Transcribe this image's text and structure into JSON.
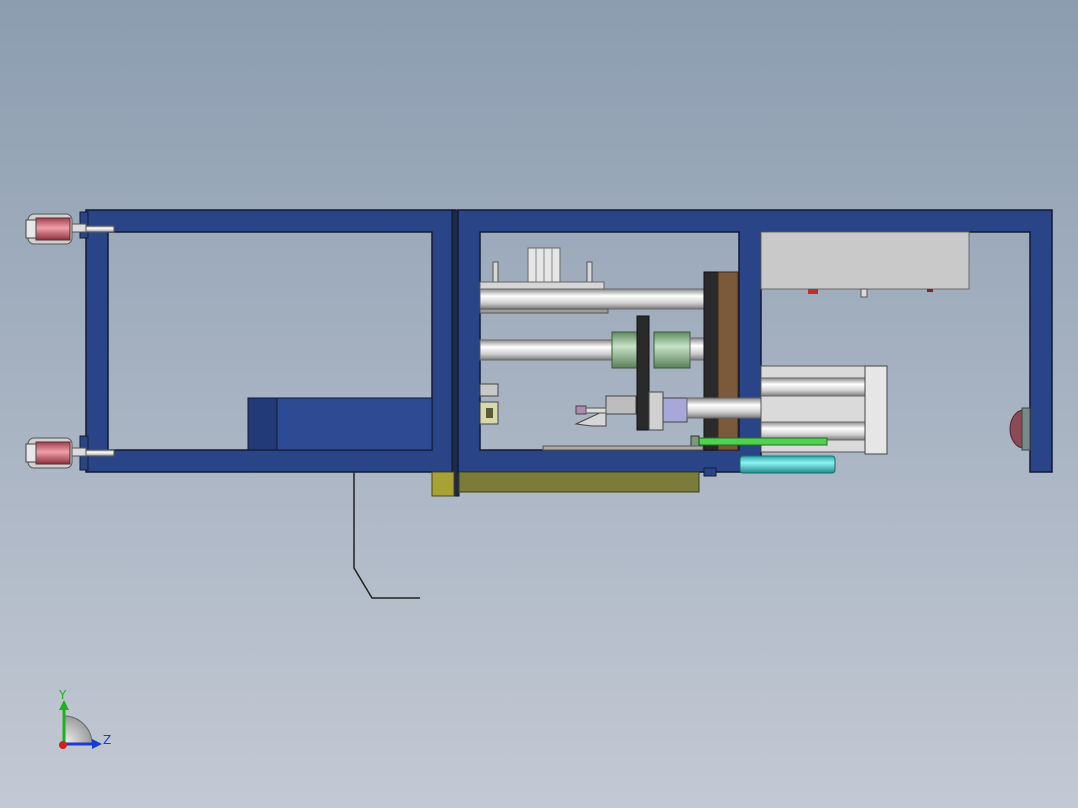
{
  "viewport": {
    "background_top": "#8c9db0",
    "background_bottom": "#c3c9d4"
  },
  "colors": {
    "frame_fill": "#2a4587",
    "frame_edge": "#111a33",
    "steel_light": "#f2f2f2",
    "steel_mid": "#bdbdbd",
    "steel_dark": "#8a8a8a",
    "olive": "#7b7b3a",
    "yellow_block": "#a7a233",
    "brown_plate": "#7a5a3a",
    "green_coupling": "#8fb58f",
    "cyan_tube": "#38c7c7",
    "green_rod": "#4fd24f",
    "red_marker": "#c44b4b",
    "pink_caster": "#e0707a",
    "grey_panel": "#c9c9c9"
  },
  "triad": {
    "y_label": "Y",
    "z_label": "Z",
    "y_color": "#1db21d",
    "z_color": "#1a3dcc",
    "x_color": "#cc2222"
  }
}
